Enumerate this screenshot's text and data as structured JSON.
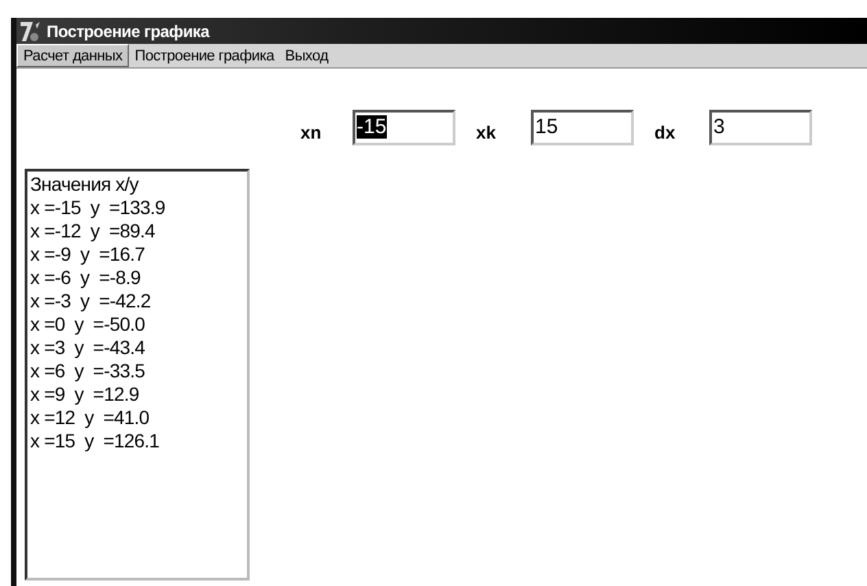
{
  "window": {
    "title": "Построение графика"
  },
  "menu": [
    {
      "label": "Расчет данных",
      "selected": true
    },
    {
      "label": "Построение графика",
      "selected": false
    },
    {
      "label": "Выход",
      "selected": false
    }
  ],
  "fields": [
    {
      "label": "xn",
      "value": "-15",
      "selected": true
    },
    {
      "label": "xk",
      "value": "15",
      "selected": false
    },
    {
      "label": "dx",
      "value": "3",
      "selected": false
    }
  ],
  "memo": {
    "lines": [
      "Значения x/y",
      "x =-15  y  =133.9",
      "x =-12  y  =89.4",
      "x =-9  y  =16.7",
      "x =-6  y  =-8.9",
      "x =-3  y  =-42.2",
      "x =0  y  =-50.0",
      "x =3  y  =-43.4",
      "x =6  y  =-33.5",
      "x =9  y  =12.9",
      "x =12  y  =41.0",
      "x =15  y  =126.1"
    ]
  }
}
